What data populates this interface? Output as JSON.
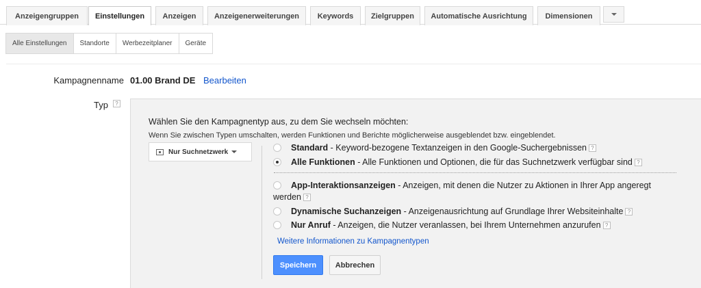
{
  "tabs": [
    {
      "label": "Anzeigengruppen",
      "active": false
    },
    {
      "label": "Einstellungen",
      "active": true
    },
    {
      "label": "Anzeigen",
      "active": false
    },
    {
      "label": "Anzeigenerweiterungen",
      "active": false
    },
    {
      "label": "Keywords",
      "active": false
    },
    {
      "label": "Zielgruppen",
      "active": false
    },
    {
      "label": "Automatische Ausrichtung",
      "active": false
    },
    {
      "label": "Dimensionen",
      "active": false
    }
  ],
  "subtabs": [
    {
      "label": "Alle Einstellungen",
      "active": true
    },
    {
      "label": "Standorte",
      "active": false
    },
    {
      "label": "Werbezeitplaner",
      "active": false
    },
    {
      "label": "Geräte",
      "active": false
    }
  ],
  "campaign": {
    "label": "Kampagnenname",
    "name": "01.00 Brand DE",
    "edit_label": "Bearbeiten"
  },
  "type_section": {
    "label": "Typ",
    "help": "?",
    "instruction": "Wählen Sie den Kampagnentyp aus, zu dem Sie wechseln möchten:",
    "note": "Wenn Sie zwischen Typen umschalten, werden Funktionen und Berichte möglicherweise ausgeblendet bzw. eingeblendet.",
    "dropdown_value": "Nur Suchnetzwerk",
    "options": [
      {
        "title": "Standard",
        "desc": " - Keyword-bezogene Textanzeigen in den Google-Suchergebnissen",
        "checked": false
      },
      {
        "title": "Alle Funktionen",
        "desc": " - Alle Funktionen und Optionen, die für das Suchnetzwerk verfügbar sind",
        "checked": true
      },
      {
        "title": "App-Interaktionsanzeigen",
        "desc": " - Anzeigen, mit denen die Nutzer zu Aktionen in Ihrer App angeregt",
        "desc2": "werden",
        "checked": false
      },
      {
        "title": "Dynamische Suchanzeigen",
        "desc": " - Anzeigenausrichtung auf Grundlage Ihrer Websiteinhalte",
        "checked": false
      },
      {
        "title": "Nur Anruf",
        "desc": " - Anzeigen, die Nutzer veranlassen, bei Ihrem Unternehmen anzurufen",
        "checked": false
      }
    ],
    "more_link": "Weitere Informationen zu Kampagnentypen",
    "save_label": "Speichern",
    "cancel_label": "Abbrechen"
  },
  "colors": {
    "link": "#1155cc",
    "primary_button": "#4d90fe",
    "panel_bg": "#f2f2f2"
  }
}
